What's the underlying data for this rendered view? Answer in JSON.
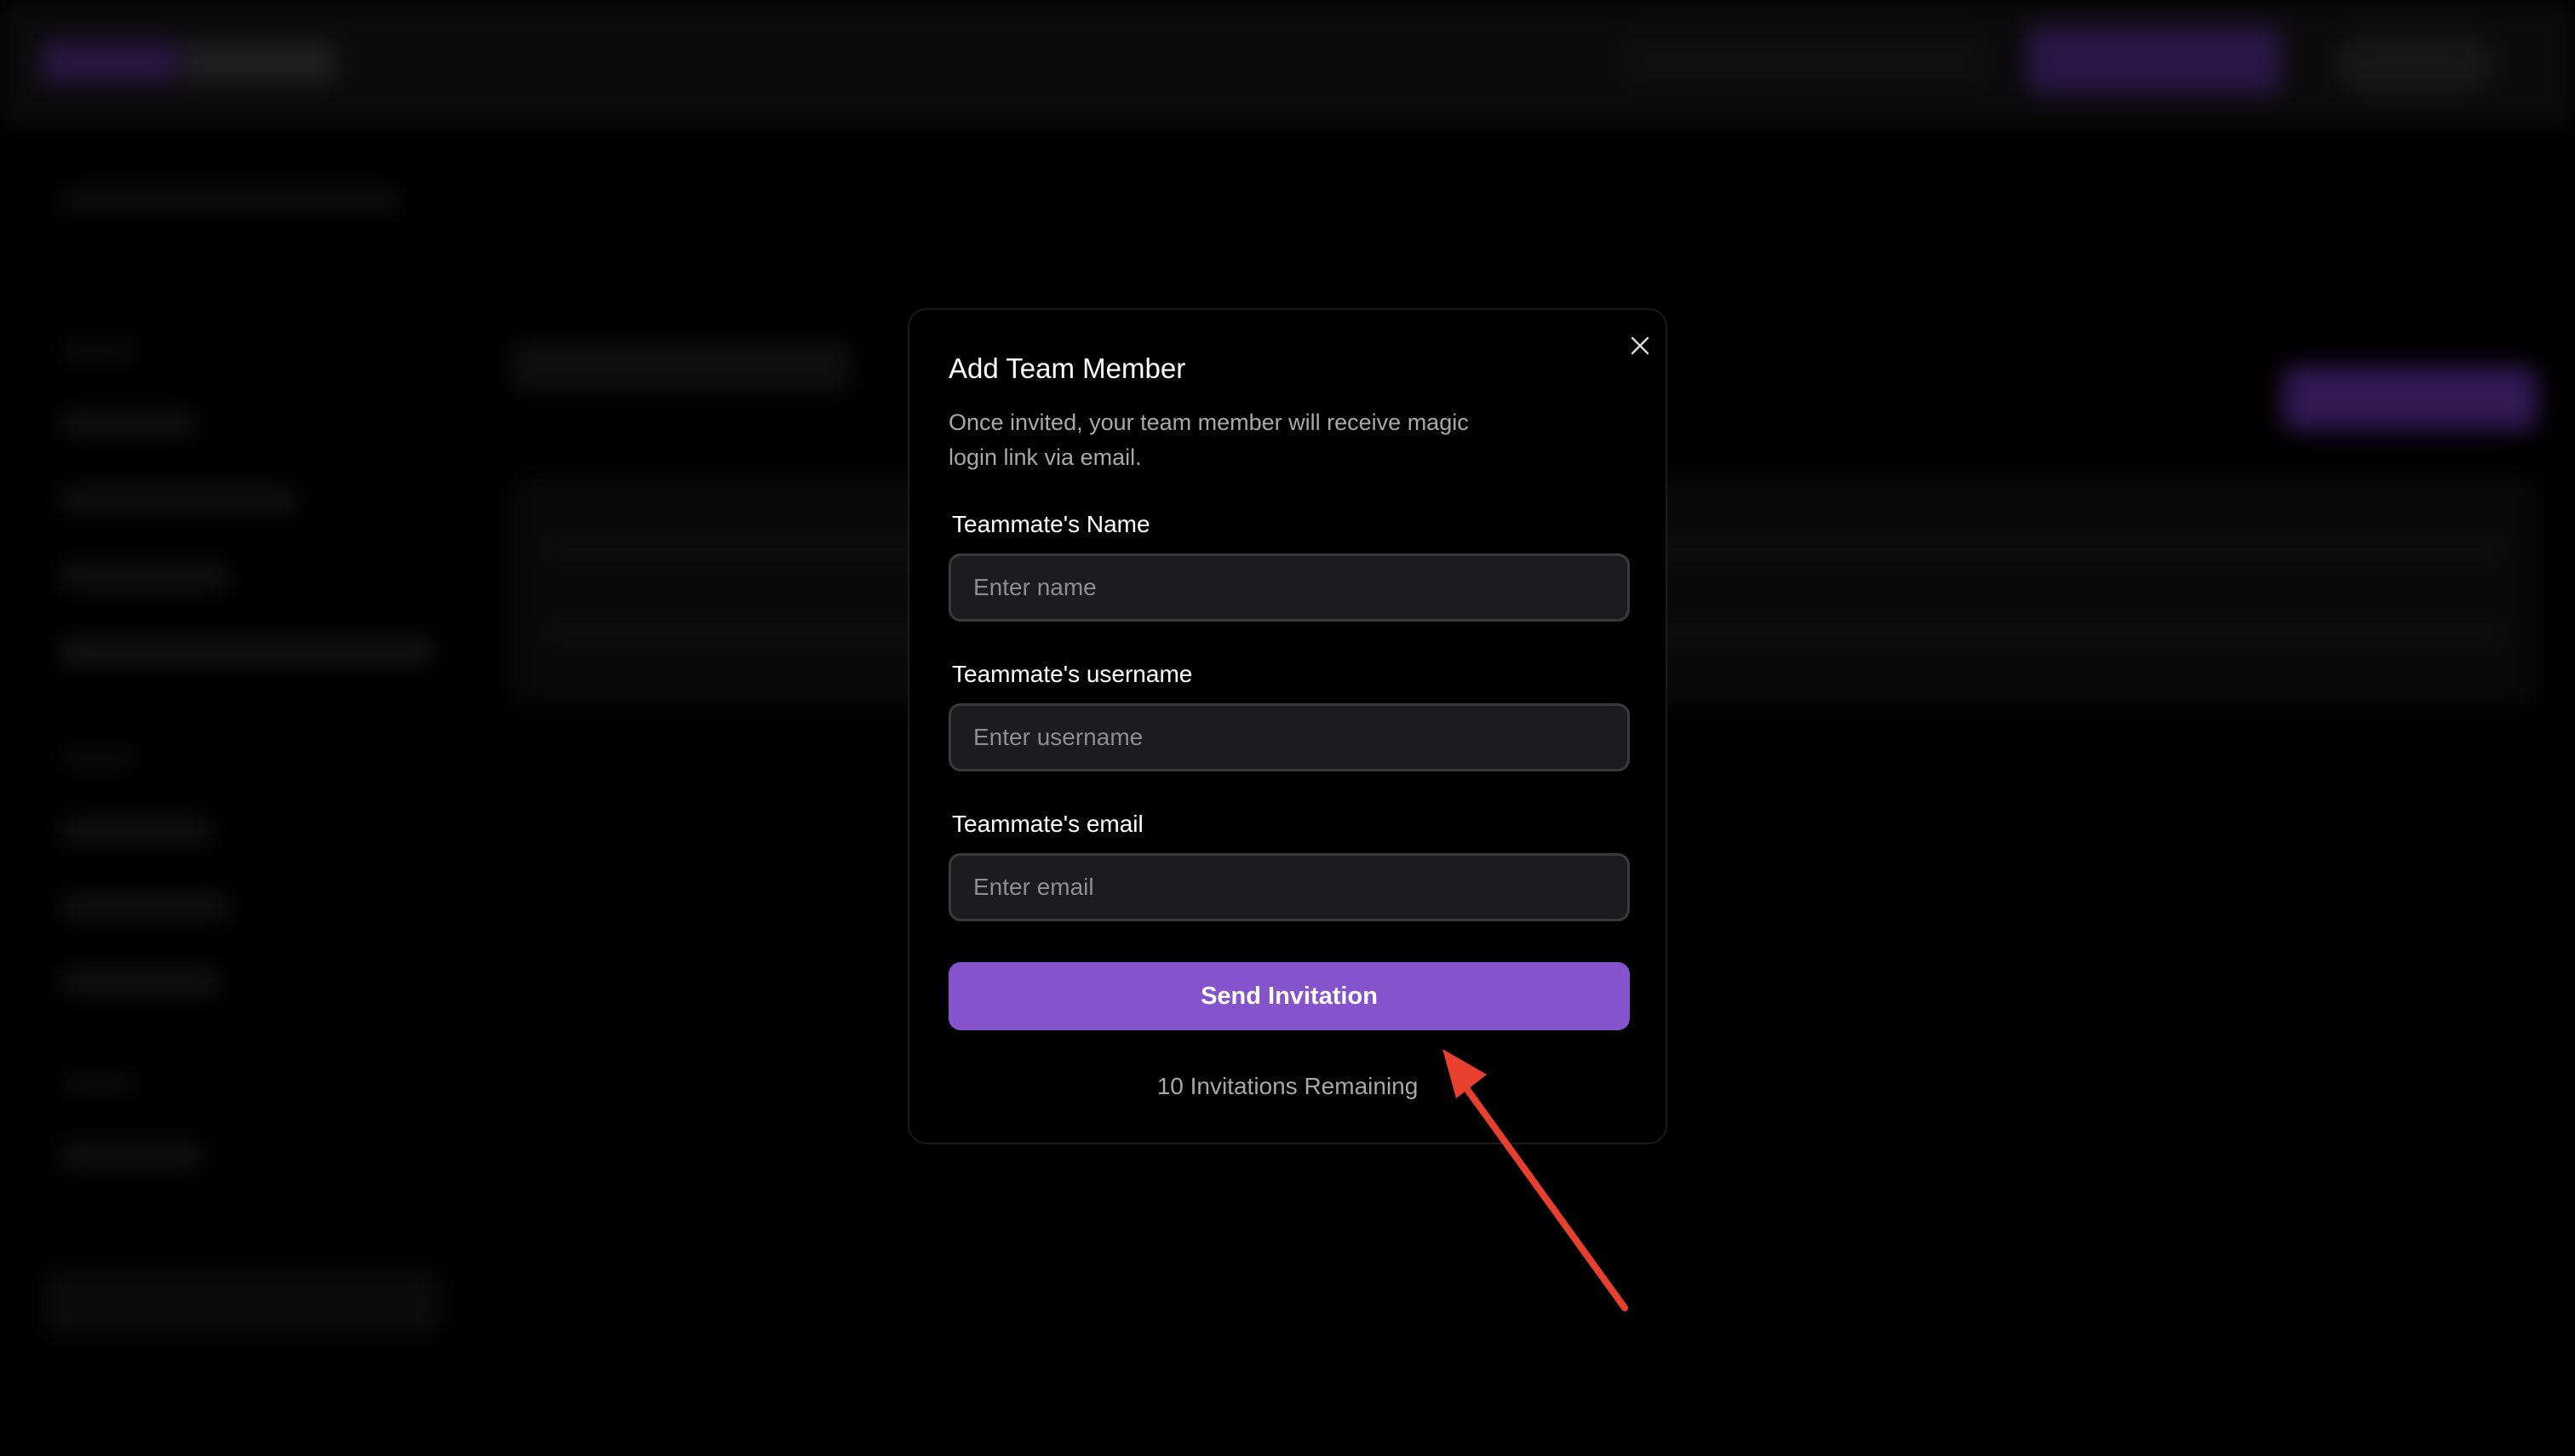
{
  "modal": {
    "title": "Add Team Member",
    "description": "Once invited, your team member will receive magic login link via email.",
    "fields": [
      {
        "label": "Teammate's Name",
        "placeholder": "Enter name"
      },
      {
        "label": "Teammate's username",
        "placeholder": "Enter username"
      },
      {
        "label": "Teammate's email",
        "placeholder": "Enter email"
      }
    ],
    "submit_label": "Send Invitation",
    "remaining_text": "10 Invitations Remaining",
    "close_icon": "close-icon"
  },
  "colors": {
    "accent": "#8553cc",
    "annotation_arrow": "#e8402f",
    "input_bg": "#1c1c1e",
    "input_border": "#3a3a3c"
  }
}
